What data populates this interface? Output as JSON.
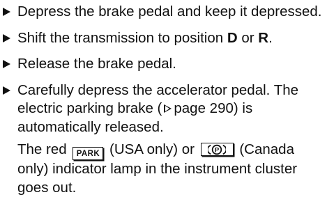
{
  "steps": [
    {
      "text": "Depress the brake pedal and keep it depressed."
    },
    {
      "pre": "Shift the transmission to position ",
      "pos1": "D",
      "mid": " or ",
      "pos2": "R",
      "post": "."
    },
    {
      "text": "Release the brake pedal."
    },
    {
      "line1": "Carefully depress the accelerator pedal. The electric parking brake (",
      "page_ref": "page 290",
      "line1_post": ") is automatically released.",
      "extra_pre": "The red ",
      "park_lamp": "PARK",
      "usa_only": " (USA only) or ",
      "brake_lamp_letter": "P",
      "canada_only": " (Canada only) indicator lamp in the instrument cluster goes out."
    }
  ],
  "icons": {
    "bullet": "triangle-right-icon",
    "page_reference": "page-reference-arrow-icon",
    "brake_lamp": "circle-p-parking-brake-icon"
  },
  "colors": {
    "text": "#111111",
    "background": "#ffffff"
  }
}
